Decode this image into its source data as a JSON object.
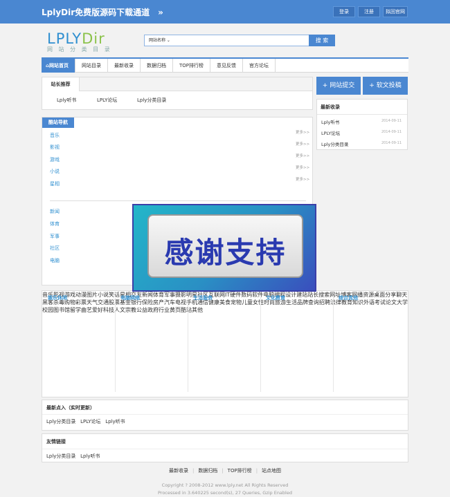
{
  "topbar": {
    "brand": "LplyDir免费版源码下载通道　»",
    "login": "登录",
    "register": "注册",
    "official": "拟回官网"
  },
  "logo": {
    "part1": "LPLY",
    "part2": "Dir",
    "sub": "网 站 分 类 目 录"
  },
  "search": {
    "category": "网站名称 ⌄",
    "placeholder": "",
    "button": "搜 索"
  },
  "nav": [
    "网站首页",
    "网站目录",
    "最新收录",
    "数据归档",
    "TOP排行榜",
    "意见反馈",
    "官方论坛"
  ],
  "recommend": {
    "title": "站长推荐",
    "links": [
      "Lply听书",
      "LPLY论坛",
      "Lply分类目录"
    ]
  },
  "buttons": {
    "submit": "+ 网站提交",
    "article": "+ 软文投稿"
  },
  "latest": {
    "title": "最新收录",
    "items": [
      {
        "name": "Lply听书",
        "date": "2014-09-11"
      },
      {
        "name": "LPLY论坛",
        "date": "2014-09-11"
      },
      {
        "name": "Lply分类目录",
        "date": "2014-09-11"
      }
    ]
  },
  "cool": {
    "title": "酷站导航",
    "group1": [
      "音乐",
      "影视",
      "游戏",
      "小说",
      "星相"
    ],
    "more": "更多>>",
    "group2": [
      "新闻",
      "体育",
      "军事",
      "社区",
      "电脑"
    ]
  },
  "overlay": {
    "text": "感谢支持"
  },
  "categories": [
    {
      "title": "娱乐休闲",
      "items": [
        "音乐",
        "影视",
        "游戏",
        "动漫",
        "图片",
        "小说",
        "笑话",
        "星相",
        "交友",
        "新闻",
        "体育",
        "军事",
        "摄影",
        "明星",
        "社区"
      ]
    },
    {
      "title": "电脑网络",
      "items": [
        "互联网",
        "IT",
        "硬件",
        "数码",
        "软件",
        "电脑",
        "编程",
        "设计",
        "建站",
        "站长",
        "搜索",
        "网址",
        "博客",
        "网播",
        "资源",
        "桌面",
        "分享",
        "聊天",
        "黑客",
        "杀毒"
      ]
    },
    {
      "title": "生活服务",
      "items": [
        "购物",
        "彩票",
        "天气",
        "交通",
        "股票",
        "基金",
        "银行",
        "保险",
        "房产",
        "汽车",
        "电视",
        "手机",
        "通信",
        "健康",
        "美食",
        "宠物",
        "儿童",
        "女性",
        "时尚",
        "旅游",
        "生活",
        "品牌",
        "查询",
        "招聘",
        "法律"
      ]
    },
    {
      "title": "文化教育",
      "items": [
        "教育",
        "知识",
        "外语",
        "考试",
        "论文",
        "大学",
        "校园",
        "图书馆",
        "留学",
        "曲艺",
        "爱好",
        "科技",
        "人文",
        "宗教",
        "公益"
      ]
    },
    {
      "title": "综合其他",
      "items": [
        "政府",
        "行业",
        "黄页",
        "酷站",
        "其他"
      ]
    }
  ],
  "recent": {
    "title": "最新点入（实时更新）",
    "links": [
      "Lply分类目录",
      "LPLY论坛",
      "Lply听书"
    ]
  },
  "friends": {
    "title": "友情链接",
    "links": [
      "Lply分类目录",
      "Lply听书"
    ]
  },
  "footer": {
    "links": [
      "最新收录",
      "数据归档",
      "TOP排行榜",
      "站点地图"
    ],
    "copyright": "Copyright ? 2008-2012 www.lply.net All Rights Reserved",
    "processed": "Processed in 3.640225 second(s), 27 Queries, Gzip Enabled"
  }
}
